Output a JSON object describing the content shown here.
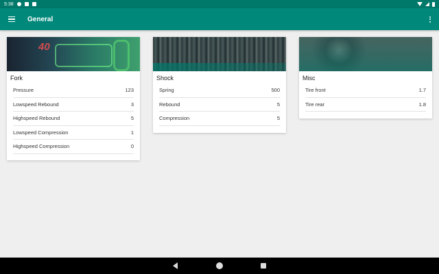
{
  "status_bar": {
    "time": "5:38",
    "icons": [
      "gear-icon",
      "notification-icon",
      "clipboard-icon",
      "wifi-icon",
      "signal-icon",
      "battery-icon"
    ]
  },
  "app_bar": {
    "title": "General",
    "background": "#00897b",
    "icons": [
      "menu-icon",
      "overflow-menu-icon"
    ]
  },
  "cards": {
    "fork": {
      "title": "Fork",
      "image_text": "40",
      "rows": [
        {
          "label": "Pressure",
          "value": "123"
        },
        {
          "label": "Lowspeed Rebound",
          "value": "3"
        },
        {
          "label": "Highspeed Rebound",
          "value": "5"
        },
        {
          "label": "Lowspeed Compression",
          "value": "1"
        },
        {
          "label": "Highspeed Compression",
          "value": "0"
        }
      ]
    },
    "shock": {
      "title": "Shock",
      "rows": [
        {
          "label": "Spring",
          "value": "500"
        },
        {
          "label": "Rebound",
          "value": "5"
        },
        {
          "label": "Compression",
          "value": "5"
        }
      ]
    },
    "misc": {
      "title": "Misc",
      "rows": [
        {
          "label": "Tire front",
          "value": "1.7"
        },
        {
          "label": "Tire rear",
          "value": "1.8"
        }
      ]
    }
  },
  "nav_bar": {
    "icons": [
      "back-icon",
      "home-icon",
      "recents-icon"
    ]
  }
}
